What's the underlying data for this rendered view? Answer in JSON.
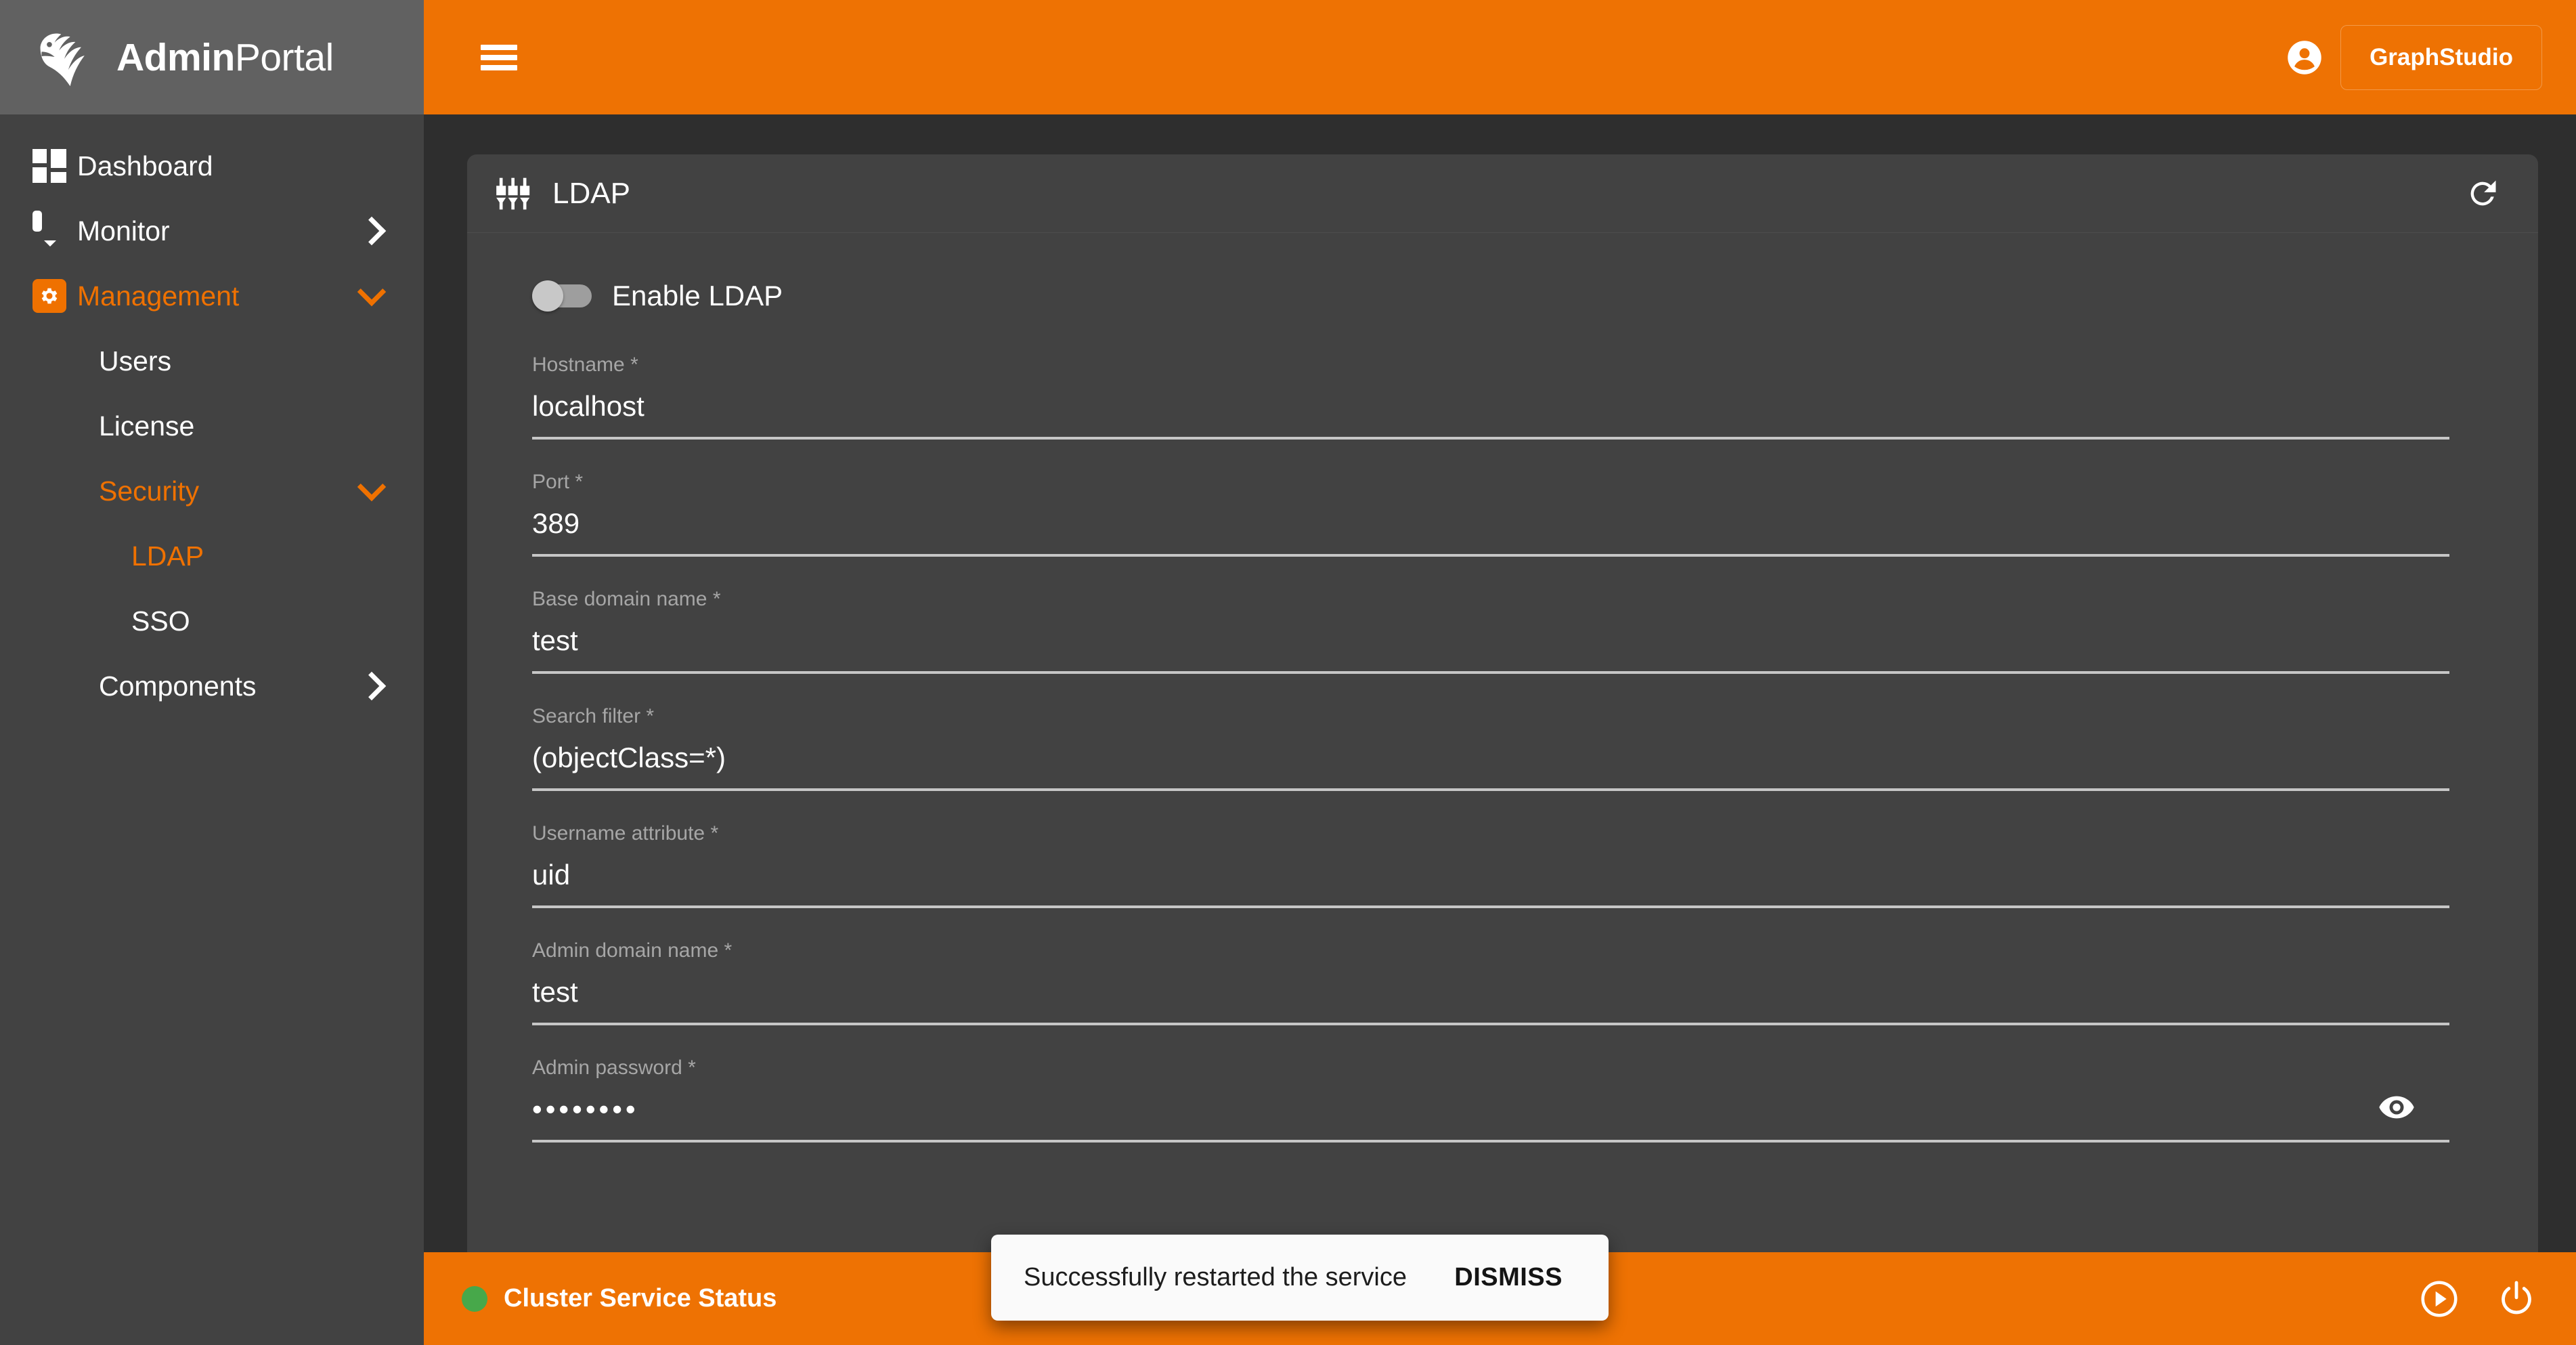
{
  "brand": {
    "logo_icon": "lion-head-logo-icon",
    "name_bold": "Admin",
    "name_light": "Portal"
  },
  "topbar": {
    "menu_icon": "hamburger-menu-icon",
    "account_icon": "account-circle-icon",
    "graphstudio_label": "GraphStudio",
    "background_color": "#ee7203"
  },
  "sidebar": {
    "background_color": "#424242",
    "accent_color": "#ef7100",
    "items": [
      {
        "label": "Dashboard",
        "icon": "dashboard-grid-icon",
        "chevron": "none",
        "active": false,
        "level": 0
      },
      {
        "label": "Monitor",
        "icon": "monitor-icon",
        "chevron": "right",
        "active": false,
        "level": 0
      },
      {
        "label": "Management",
        "icon": "gear-square-icon",
        "chevron": "down",
        "active": true,
        "level": 0
      },
      {
        "label": "Users",
        "icon": "none",
        "chevron": "none",
        "active": false,
        "level": 1
      },
      {
        "label": "License",
        "icon": "none",
        "chevron": "none",
        "active": false,
        "level": 1
      },
      {
        "label": "Security",
        "icon": "none",
        "chevron": "down",
        "active": true,
        "level": 1
      },
      {
        "label": "LDAP",
        "icon": "none",
        "chevron": "none",
        "active": true,
        "level": 2
      },
      {
        "label": "SSO",
        "icon": "none",
        "chevron": "none",
        "active": false,
        "level": 2
      },
      {
        "label": "Components",
        "icon": "none",
        "chevron": "right",
        "active": false,
        "level": 1
      }
    ]
  },
  "card": {
    "icon": "tune-sliders-icon",
    "title": "LDAP",
    "refresh_icon": "refresh-icon",
    "toggle": {
      "label": "Enable LDAP",
      "state": "off"
    },
    "fields": [
      {
        "label": "Hostname *",
        "value": "localhost",
        "type": "text"
      },
      {
        "label": "Port *",
        "value": "389",
        "type": "text"
      },
      {
        "label": "Base domain name *",
        "value": "test",
        "type": "text"
      },
      {
        "label": "Search filter *",
        "value": "(objectClass=*)",
        "type": "text"
      },
      {
        "label": "Username attribute *",
        "value": "uid",
        "type": "text"
      },
      {
        "label": "Admin domain name *",
        "value": "test",
        "type": "text"
      },
      {
        "label": "Admin password *",
        "value": "••••••••",
        "type": "password",
        "reveal_icon": "eye-visibility-icon"
      }
    ]
  },
  "bottombar": {
    "background_color": "#ee7203",
    "status_label": "Cluster Service Status",
    "status_color": "#47a84a",
    "actions": [
      {
        "icon": "play-circle-icon"
      },
      {
        "icon": "power-icon"
      }
    ]
  },
  "snackbar": {
    "message": "Successfully restarted the service",
    "action_label": "DISMISS"
  }
}
